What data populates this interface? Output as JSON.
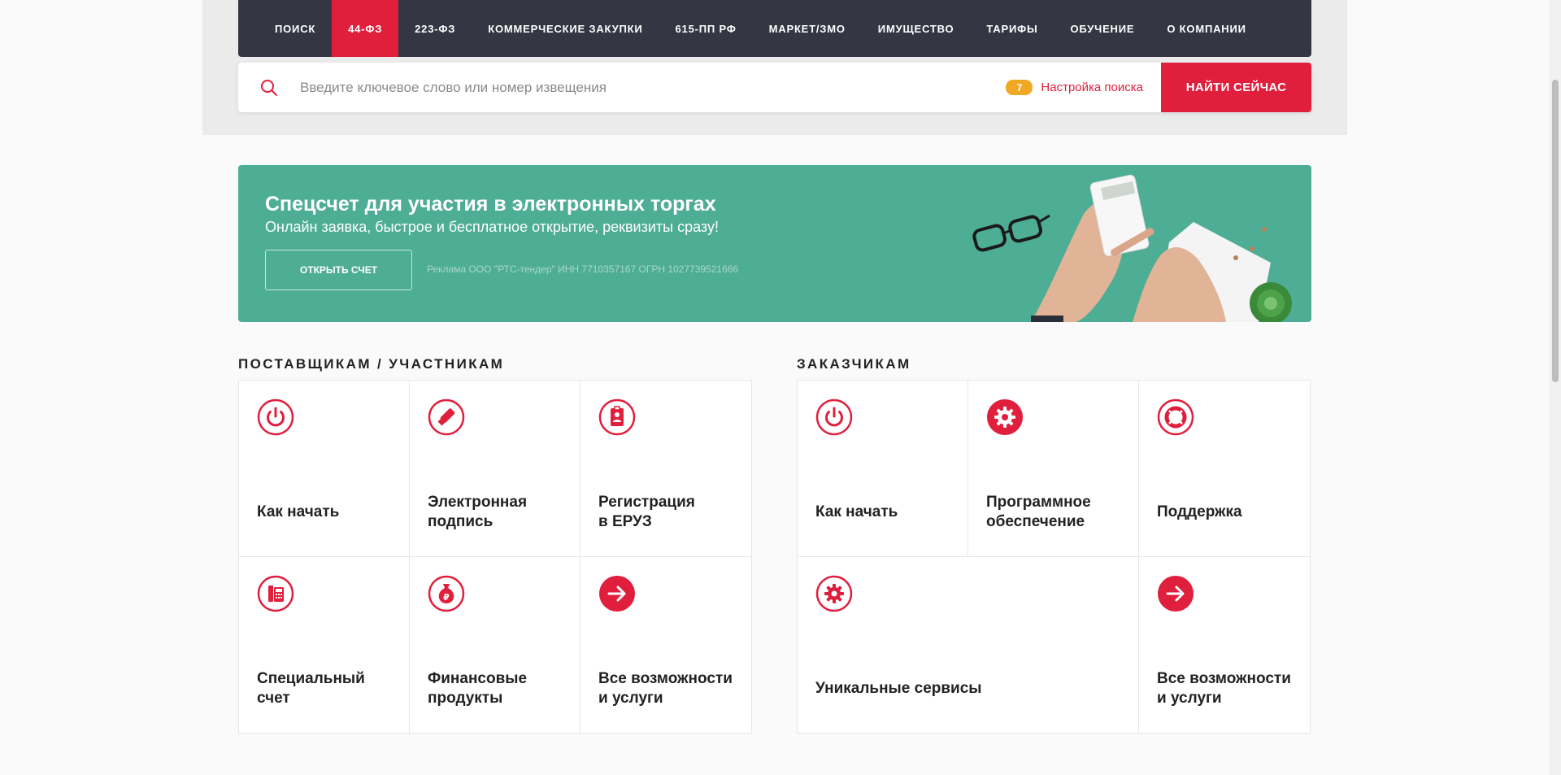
{
  "nav": {
    "items": [
      {
        "label": "Поиск"
      },
      {
        "label": "44-ФЗ"
      },
      {
        "label": "223-ФЗ"
      },
      {
        "label": "Коммерческие закупки"
      },
      {
        "label": "615-ПП РФ"
      },
      {
        "label": "Маркет/ЗМО"
      },
      {
        "label": "Имущество"
      },
      {
        "label": "Тарифы"
      },
      {
        "label": "Обучение"
      },
      {
        "label": "О компании"
      }
    ],
    "active_label": "44-ФЗ"
  },
  "search": {
    "placeholder": "Введите ключевое слово или номер извещения",
    "value": "",
    "settings_count": "7",
    "settings_label": "Настройка поиска",
    "button_label": "Найти сейчас"
  },
  "promo": {
    "title": "Спецсчет для участия в электронных торгах",
    "subtitle": "Онлайн заявка, быстрое и бесплатное открытие, реквизиты сразу!",
    "button_label": "Открыть счет",
    "ad_text": "Реклама ООО \"РТС-тендер\" ИНН 7710357167 ОГРН 1027739521666"
  },
  "suppliers": {
    "title": "Поставщикам / участникам",
    "tiles": [
      {
        "label": "Как начать",
        "icon": "power-icon"
      },
      {
        "label": "Электронная\nподпись",
        "icon": "usb-key-icon"
      },
      {
        "label": "Регистрация\nв ЕРУЗ",
        "icon": "id-badge-icon"
      },
      {
        "label": "Специальный\nсчет",
        "icon": "calculator-icon"
      },
      {
        "label": "Финансовые\nпродукты",
        "icon": "money-bag-icon"
      },
      {
        "label": "Все возможности\nи услуги",
        "icon": "arrow-right-icon"
      }
    ]
  },
  "customers": {
    "title": "Заказчикам",
    "tiles": [
      {
        "label": "Как начать",
        "icon": "power-icon"
      },
      {
        "label": "Программное\nобеспечение",
        "icon": "gear-icon"
      },
      {
        "label": "Поддержка",
        "icon": "lifebuoy-icon"
      },
      {
        "label": "Уникальные сервисы",
        "icon": "gear-icon"
      },
      {
        "label": "Все возможности\nи услуги",
        "icon": "arrow-right-icon"
      }
    ]
  },
  "colors": {
    "accent": "#e01f3d",
    "nav_bg": "#343743",
    "promo_bg": "#4ead95",
    "badge": "#f0a925"
  }
}
